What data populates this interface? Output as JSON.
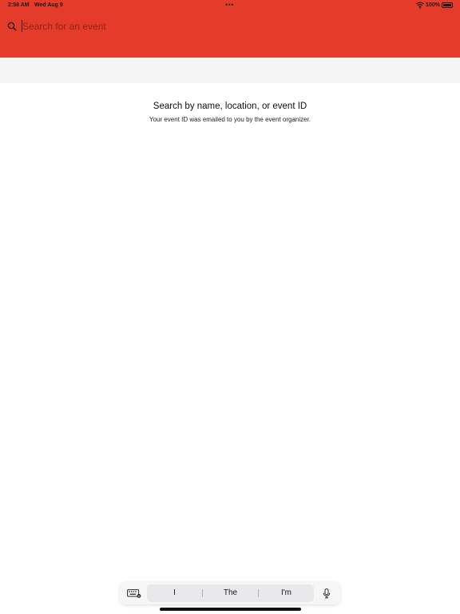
{
  "status_bar": {
    "time": "2:58 AM",
    "date": "Wed Aug 9",
    "multitasking_dots": "•••",
    "battery_percent": "100%",
    "battery_level": 1.0,
    "wifi_icon": "wifi-icon"
  },
  "header": {
    "background_color": "#e53b2a",
    "search": {
      "icon": "search-icon",
      "placeholder": "Search for an event",
      "value": ""
    }
  },
  "empty_state": {
    "title": "Search by name, location, or event ID",
    "subtitle": "Your event ID was emailed to you by the event organizer."
  },
  "keyboard_bar": {
    "left_icon": "keyboard-icon",
    "suggestions": [
      "I",
      "The",
      "I'm"
    ],
    "right_icon": "microphone-icon"
  }
}
